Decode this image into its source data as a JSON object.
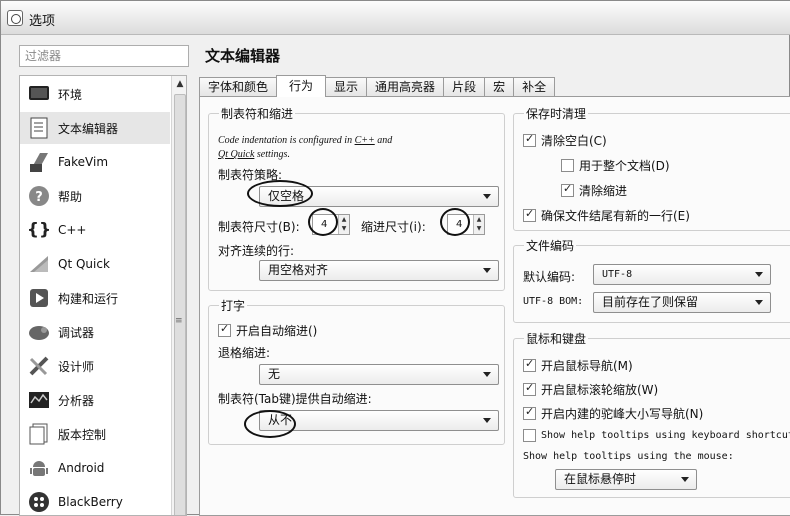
{
  "window": {
    "title": "选项"
  },
  "filter": {
    "placeholder": "过滤器"
  },
  "sidebar": {
    "items": [
      {
        "label": "环境",
        "icon": "monitor-icon"
      },
      {
        "label": "文本编辑器",
        "icon": "document-icon"
      },
      {
        "label": "FakeVim",
        "icon": "fakevim-icon"
      },
      {
        "label": "帮助",
        "icon": "help-icon"
      },
      {
        "label": "C++",
        "icon": "braces-icon"
      },
      {
        "label": "Qt Quick",
        "icon": "qt-quick-icon"
      },
      {
        "label": "构建和运行",
        "icon": "build-icon"
      },
      {
        "label": "调试器",
        "icon": "debugger-icon"
      },
      {
        "label": "设计师",
        "icon": "designer-icon"
      },
      {
        "label": "分析器",
        "icon": "analyzer-icon"
      },
      {
        "label": "版本控制",
        "icon": "version-control-icon"
      },
      {
        "label": "Android",
        "icon": "android-icon"
      },
      {
        "label": "BlackBerry",
        "icon": "blackberry-icon"
      }
    ]
  },
  "page_title": "文本编辑器",
  "tabs": [
    "字体和颜色",
    "行为",
    "显示",
    "通用高亮器",
    "片段",
    "宏",
    "补全"
  ],
  "tabs_indent": {
    "title": "制表符和缩进",
    "note_prefix": "Code indentation is configured in ",
    "note_link1": "C++",
    "note_mid": " and",
    "note_link2": "Qt Quick",
    "note_suffix": " settings.",
    "policy_label": "制表符策略:",
    "policy_value": "仅空格",
    "tab_size_label": "制表符尺寸(B):",
    "tab_size_value": "4",
    "indent_size_label": "缩进尺寸(i):",
    "indent_size_value": "4",
    "align_label": "对齐连续的行:",
    "align_value": "用空格对齐"
  },
  "typing": {
    "title": "打字",
    "auto_indent_label": "开启自动缩进()",
    "backspace_label": "退格缩进:",
    "backspace_value": "无",
    "tab_key_label": "制表符(Tab键)提供自动缩进:",
    "tab_key_value": "从不"
  },
  "cleanup": {
    "title": "保存时清理",
    "clean_ws_label": "清除空白(C)",
    "entire_doc_label": "用于整个文档(D)",
    "clean_indent_label": "清除缩进",
    "newline_label": "确保文件结尾有新的一行(E)"
  },
  "encoding": {
    "title": "文件编码",
    "default_label": "默认编码:",
    "default_value": "UTF-8",
    "bom_label": "UTF-8 BOM:",
    "bom_value": "目前存在了则保留"
  },
  "mouse": {
    "title": "鼠标和键盘",
    "nav_label": "开启鼠标导航(M)",
    "scroll_zoom_label": "开启鼠标滚轮缩放(W)",
    "camelcase_label": "开启内建的驼峰大小写导航(N)",
    "kb_tooltips_label": "Show help tooltips using keyboard shortcut",
    "mouse_tooltips_label": "Show help tooltips using the mouse:",
    "mouse_tooltips_value": "在鼠标悬停时"
  },
  "checks": {
    "auto_indent": true,
    "clean_ws": true,
    "entire_doc": false,
    "clean_indent": true,
    "newline": true,
    "mouse_nav": true,
    "scroll_zoom": true,
    "camelcase": true,
    "kb_tooltips": false
  }
}
